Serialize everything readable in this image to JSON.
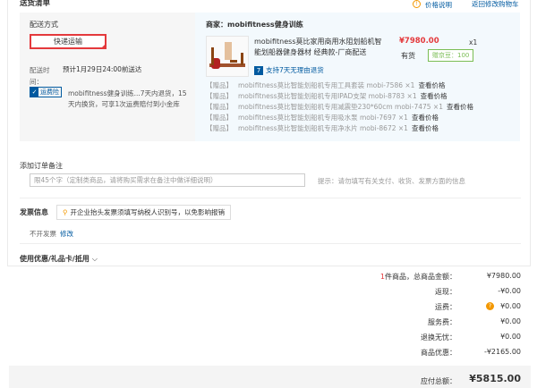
{
  "header": {
    "title": "送货清单",
    "price_note": "价格说明",
    "back_link": "返回修改购物车"
  },
  "shipping": {
    "method_label": "配送方式",
    "method_value": "快递运输",
    "time_label": "配送时间：",
    "time_value": "预计1月29日24:00前送达",
    "return_tag": "运费险",
    "return_text": "mobifitness健身训练...7天内退货，15天内换货，可享1次运费赔付到小金库"
  },
  "seller": {
    "label": "商家：mobifitness健身训练"
  },
  "product": {
    "name": "mobifitness莫比家用商用水阻划船机智能划船器健身器材 经典款-厂商配送",
    "price": "¥7980.00",
    "qty": "x1",
    "stock": "有货",
    "bean": "赠京豆：100",
    "return_label": "支持7天无理由退货"
  },
  "gifts": [
    {
      "tag": "【赠品】",
      "name": "mobifitness莫比智能划船机专用工具套装 mobi-7586 ×1",
      "view": "查看价格"
    },
    {
      "tag": "【赠品】",
      "name": "mobifitness莫比智能划船机专用IPAD支架 mobi-8783 ×1",
      "view": "查看价格"
    },
    {
      "tag": "【赠品】",
      "name": "mobifitness莫比智能划船机专用减震垫230*60cm mobi-7475 ×1",
      "view": "查看价格"
    },
    {
      "tag": "【赠品】",
      "name": "mobifitness莫比智能划船机专用吸水泵 mobi-7697 ×1",
      "view": "查看价格"
    },
    {
      "tag": "【赠品】",
      "name": "mobifitness莫比智能划船机专用净水片 mobi-8672 ×1",
      "view": "查看价格"
    }
  ],
  "remark": {
    "label": "添加订单备注",
    "placeholder": "限45个字（定制类商品，请将购买需求在备注中做详细说明）",
    "hint": "提示：请勿填写有关支付、收货、发票方面的信息"
  },
  "invoice": {
    "label": "发票信息",
    "tip": "开企业抬头发票须填写纳税人识别号，以免影响报销",
    "value": "不开发票",
    "edit": "修改"
  },
  "coupon": {
    "label": "使用优惠/礼品卡/抵用"
  },
  "summary": {
    "count_num": "1",
    "count_text": "件商品，总商品金额：",
    "total_goods": "¥7980.00",
    "rebate_label": "返现：",
    "rebate": "-¥0.00",
    "freight_label": "运费：",
    "freight": "¥0.00",
    "service_label": "服务费：",
    "service": "¥0.00",
    "return_label": "退换无忧：",
    "return_val": "¥0.00",
    "discount_label": "商品优惠：",
    "discount": "-¥2165.00",
    "payable_label": "应付总额：",
    "payable": "¥5815.00"
  },
  "colors": {
    "accent_red": "#e4393c",
    "link_blue": "#005aa0",
    "bean_green": "#7abd54",
    "info_orange": "#f39800"
  },
  "icons": [
    "info-icon",
    "question-icon",
    "chevron-down-icon",
    "location-pin-icon"
  ]
}
